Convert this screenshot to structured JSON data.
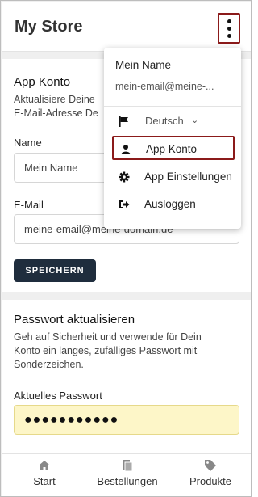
{
  "header": {
    "title": "My Store"
  },
  "account": {
    "title": "App Konto",
    "description_line1": "Aktualisiere Deine",
    "description_line2": "E-Mail-Adresse De",
    "name_label": "Name",
    "name_value": "Mein Name",
    "email_label": "E-Mail",
    "email_value": "meine-email@meine-domain.de",
    "save_label": "SPEICHERN"
  },
  "password": {
    "title": "Passwort aktualisieren",
    "description_line1": "Geh auf Sicherheit und verwende für Dein",
    "description_line2": "Konto ein langes, zufälliges Passwort mit",
    "description_line3": "Sonderzeichen.",
    "current_label": "Aktuelles Passwort",
    "current_value": "●●●●●●●●●●●"
  },
  "menu": {
    "user_name": "Mein Name",
    "user_email": "mein-email@meine-...",
    "language": "Deutsch",
    "items": [
      {
        "label": "App Konto",
        "icon": "user-icon"
      },
      {
        "label": "App Einstellungen",
        "icon": "gear-icon"
      },
      {
        "label": "Ausloggen",
        "icon": "logout-icon"
      }
    ]
  },
  "bottom_nav": [
    {
      "label": "Start",
      "icon": "home-icon"
    },
    {
      "label": "Bestellungen",
      "icon": "orders-icon"
    },
    {
      "label": "Produkte",
      "icon": "tag-icon"
    }
  ],
  "colors": {
    "highlight_border": "#8b1a1a",
    "button_bg": "#1f2d3d",
    "autofill_bg": "#fdf6c8"
  }
}
